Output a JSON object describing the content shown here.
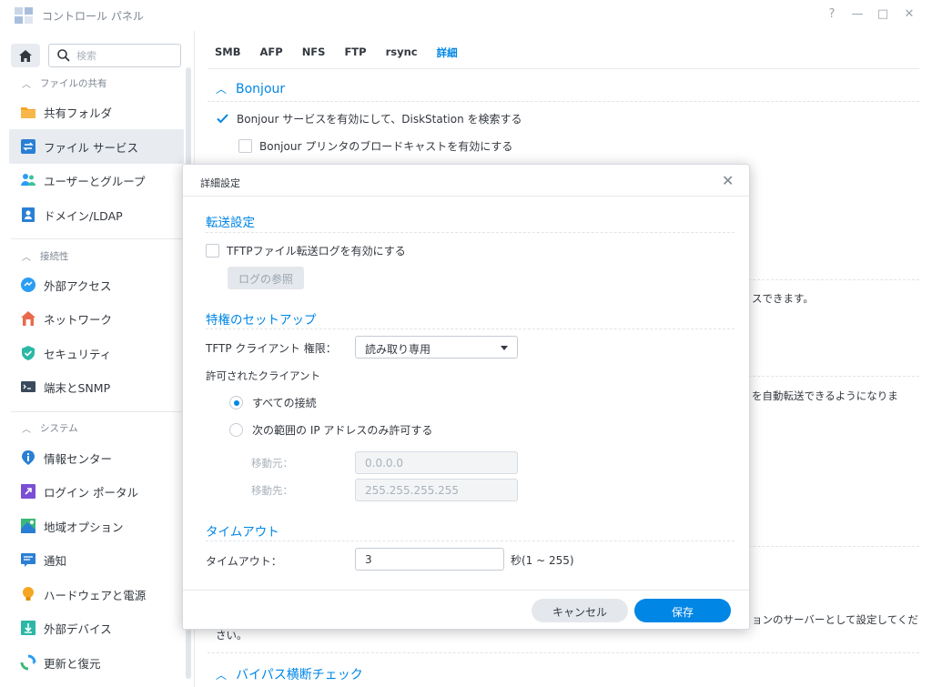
{
  "window": {
    "title": "コントロール パネル",
    "controls": {
      "help": "?",
      "minimize": "—",
      "maximize": "□",
      "close": "✕"
    }
  },
  "sidebar": {
    "search_placeholder": "検索",
    "sections": [
      {
        "label": "ファイルの共有",
        "items": [
          "共有フォルダ",
          "ファイル サービス",
          "ユーザーとグループ",
          "ドメイン/LDAP"
        ]
      },
      {
        "label": "接続性",
        "items": [
          "外部アクセス",
          "ネットワーク",
          "セキュリティ",
          "端末とSNMP"
        ]
      },
      {
        "label": "システム",
        "items": [
          "情報センター",
          "ログイン ポータル",
          "地域オプション",
          "通知",
          "ハードウェアと電源",
          "外部デバイス",
          "更新と復元"
        ]
      }
    ],
    "active_item": "ファイル サービス"
  },
  "main": {
    "tabs": [
      "SMB",
      "AFP",
      "NFS",
      "FTP",
      "rsync",
      "詳細"
    ],
    "active_tab": "詳細",
    "bonjour_title": "Bonjour",
    "bonjour_opt1": "Bonjour サービスを有効にして、DiskStation を検索する",
    "bonjour_opt2": "Bonjour プリンタのブロードキャストを有効にする",
    "frag1": "スできます。",
    "frag2": "を自動転送できるようになりま",
    "frag3a": "ョンのサーバーとして設定してくだ",
    "frag3b": "さい。",
    "bypass_title": "バイパス横断チェック"
  },
  "dialog": {
    "title": "詳細設定",
    "close": "✕",
    "transfer": {
      "heading": "転送設定",
      "log_checkbox": "TFTPファイル転送ログを有効にする",
      "log_checked": false,
      "view_log_button": "ログの参照"
    },
    "privilege": {
      "heading": "特権のセットアップ",
      "permission_label": "TFTP クライアント 権限：",
      "permission_value": "読み取り専用",
      "allowed_label": "許可されたクライアント",
      "radio_all": "すべての接続",
      "radio_range": "次の範囲の IP アドレスのみ許可する",
      "selected": "すべての接続",
      "from_label": "移動元：",
      "from_value": "0.0.0.0",
      "to_label": "移動先：",
      "to_value": "255.255.255.255"
    },
    "timeout": {
      "heading": "タイムアウト",
      "label": "タイムアウト：",
      "value": "3",
      "unit": "秒(1 ~ 255)"
    },
    "buttons": {
      "cancel": "キャンセル",
      "save": "保存"
    }
  },
  "colors": {
    "accent": "#0086e5",
    "text": "#33383f",
    "muted": "#7c8590"
  }
}
